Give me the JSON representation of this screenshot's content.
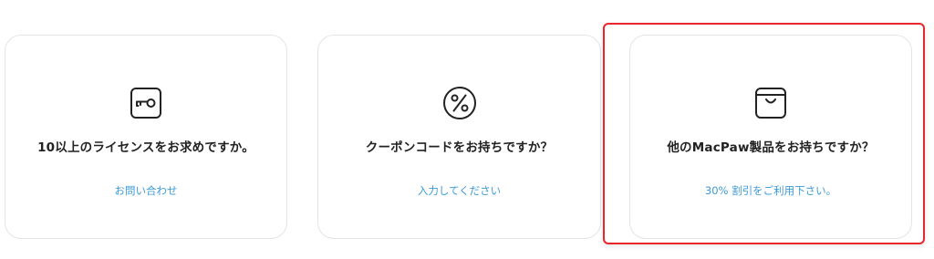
{
  "cards": [
    {
      "icon": "key-icon",
      "title": "10以上のライセンスをお求めですか。",
      "link_label": "お問い合わせ"
    },
    {
      "icon": "percent-icon",
      "title": "クーポンコードをお持ちですか？",
      "link_label": "入力してください"
    },
    {
      "icon": "shopping-bag-icon",
      "title": "他のMacPaw製品をお持ちですか？",
      "link_label": "30% 割引をご利用下さい。",
      "highlighted": true
    }
  ],
  "colors": {
    "link": "#3d9ad8",
    "title": "#222222",
    "card_border": "#e4e4e4",
    "highlight_border": "#e8262c"
  }
}
